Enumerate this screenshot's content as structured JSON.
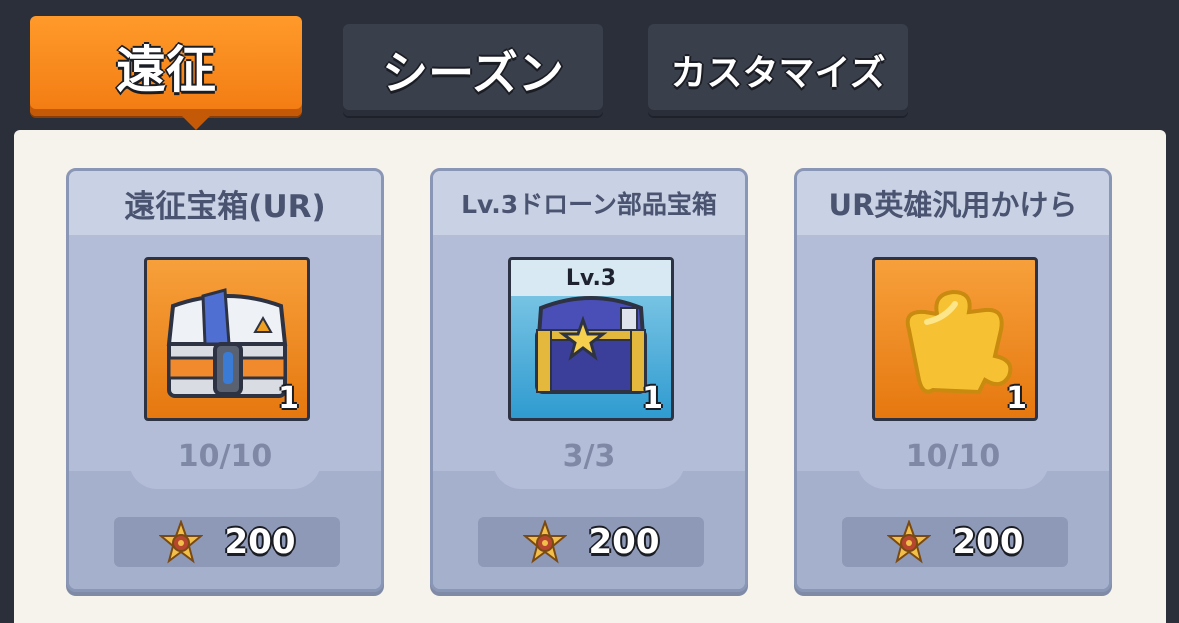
{
  "tabs": [
    {
      "label": "遠征",
      "active": true
    },
    {
      "label": "シーズン",
      "active": false
    },
    {
      "label": "カスタマイズ",
      "active": false
    }
  ],
  "items": [
    {
      "title": "遠征宝箱(UR)",
      "count": "1",
      "stock": "10/10",
      "price": "200",
      "icon": "ur-chest-icon",
      "level_badge": ""
    },
    {
      "title": "Lv.3ドローン部品宝箱",
      "count": "1",
      "stock": "3/3",
      "price": "200",
      "icon": "drone-parts-chest-icon",
      "level_badge": "Lv.3"
    },
    {
      "title": "UR英雄汎用かけら",
      "count": "1",
      "stock": "10/10",
      "price": "200",
      "icon": "hero-fragment-icon",
      "level_badge": ""
    }
  ],
  "colors": {
    "accent": "#f27b12",
    "background": "#2b2f3a",
    "panel": "#f6f2ec",
    "card": "#aab5d1"
  }
}
